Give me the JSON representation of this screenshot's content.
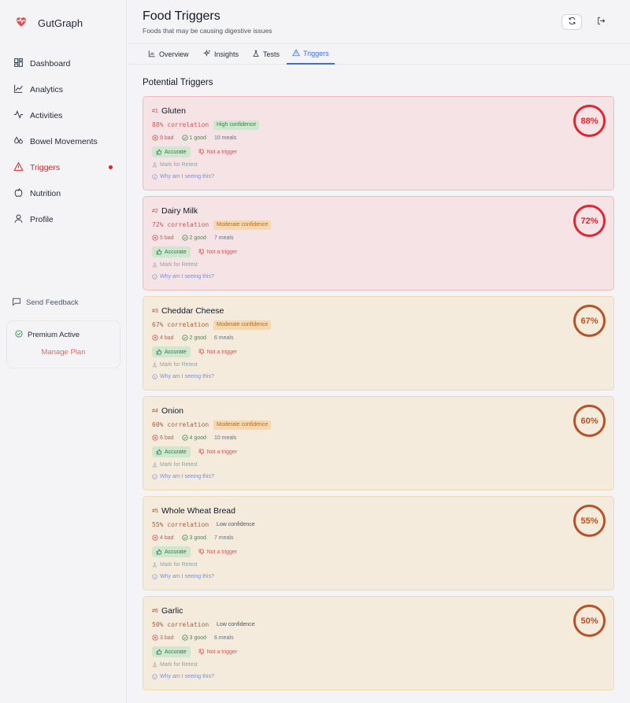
{
  "app": {
    "name": "GutGraph"
  },
  "sidebar": {
    "items": [
      {
        "label": "Dashboard",
        "icon": "dashboard-icon"
      },
      {
        "label": "Analytics",
        "icon": "analytics-icon"
      },
      {
        "label": "Activities",
        "icon": "activity-icon"
      },
      {
        "label": "Bowel Movements",
        "icon": "droplets-icon"
      },
      {
        "label": "Triggers",
        "icon": "warning-icon",
        "active": true
      },
      {
        "label": "Nutrition",
        "icon": "apple-icon"
      },
      {
        "label": "Profile",
        "icon": "user-icon"
      }
    ],
    "feedback": "Send Feedback",
    "premium": {
      "status": "Premium Active",
      "manage": "Manage Plan"
    }
  },
  "header": {
    "title": "Food Triggers",
    "subtitle": "Foods that may be causing digestive issues"
  },
  "tabs": [
    {
      "label": "Overview"
    },
    {
      "label": "Insights"
    },
    {
      "label": "Tests"
    },
    {
      "label": "Triggers",
      "active": true
    }
  ],
  "main": {
    "section_title": "Potential Triggers",
    "labels": {
      "accurate": "Accurate",
      "not_trigger": "Not a trigger",
      "retest": "Mark for Retest",
      "why": "Why am I seeing this?"
    },
    "triggers": [
      {
        "rank": "#1",
        "food": "Gluten",
        "correlation": "88% correlation",
        "confidence": "High confidence",
        "bad": "9 bad",
        "good": "1 good",
        "meals": "10 meals",
        "percent": "88%"
      },
      {
        "rank": "#2",
        "food": "Dairy Milk",
        "correlation": "72% correlation",
        "confidence": "Moderate confidence",
        "bad": "5 bad",
        "good": "2 good",
        "meals": "7 meals",
        "percent": "72%"
      },
      {
        "rank": "#3",
        "food": "Cheddar Cheese",
        "correlation": "67% correlation",
        "confidence": "Moderate confidence",
        "bad": "4 bad",
        "good": "2 good",
        "meals": "6 meals",
        "percent": "67%"
      },
      {
        "rank": "#4",
        "food": "Onion",
        "correlation": "60% correlation",
        "confidence": "Moderate confidence",
        "bad": "6 bad",
        "good": "4 good",
        "meals": "10 meals",
        "percent": "60%"
      },
      {
        "rank": "#5",
        "food": "Whole Wheat Bread",
        "correlation": "55% correlation",
        "confidence": "Low confidence",
        "bad": "4 bad",
        "good": "3 good",
        "meals": "7 meals",
        "percent": "55%"
      },
      {
        "rank": "#6",
        "food": "Garlic",
        "correlation": "50% correlation",
        "confidence": "Low confidence",
        "bad": "3 bad",
        "good": "3 good",
        "meals": "6 meals",
        "percent": "50%"
      }
    ]
  },
  "colors": {
    "accent": "#3b6fd6",
    "danger": "#e0262f",
    "warning": "#b65226",
    "success": "#2f7a45"
  }
}
